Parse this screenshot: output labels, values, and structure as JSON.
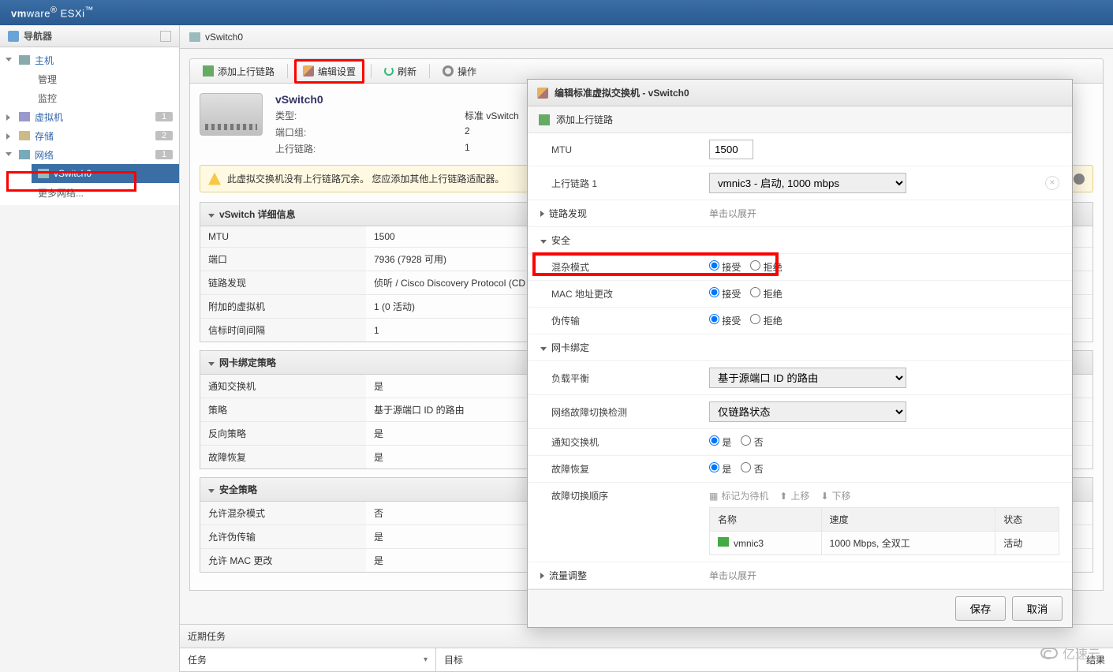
{
  "brand": {
    "a": "vm",
    "b": "ware",
    "c": " ESXi"
  },
  "nav": {
    "title": "导航器",
    "host": "主机",
    "manage": "管理",
    "monitor": "监控",
    "vm": "虚拟机",
    "vm_badge": "1",
    "ds": "存储",
    "ds_badge": "2",
    "net": "网络",
    "net_badge": "1",
    "vswitch": "vSwitch0",
    "more": "更多网络..."
  },
  "crumb": "vSwitch0",
  "toolbar": {
    "add": "添加上行链路",
    "edit": "编辑设置",
    "refresh": "刷新",
    "actions": "操作"
  },
  "card": {
    "name": "vSwitch0",
    "type_k": "类型:",
    "type_v": "标准 vSwitch",
    "pg_k": "端口组:",
    "pg_v": "2",
    "ul_k": "上行链路:",
    "ul_v": "1"
  },
  "notice": "此虚拟交换机没有上行链路冗余。 您应添加其他上行链路适配器。",
  "panel_detail": {
    "title": "vSwitch 详细信息",
    "mtu_k": "MTU",
    "mtu_v": "1500",
    "port_k": "端口",
    "port_v": "7936 (7928 可用)",
    "disc_k": "链路发现",
    "disc_v": "侦听 / Cisco Discovery Protocol (CD",
    "att_k": "附加的虚拟机",
    "att_v": "1 (0 活动)",
    "beacon_k": "信标时间间隔",
    "beacon_v": "1"
  },
  "panel_team": {
    "title": "网卡绑定策略",
    "notify_k": "通知交换机",
    "notify_v": "是",
    "policy_k": "策略",
    "policy_v": "基于源端口 ID 的路由",
    "rev_k": "反向策略",
    "rev_v": "是",
    "fb_k": "故障恢复",
    "fb_v": "是"
  },
  "panel_sec": {
    "title": "安全策略",
    "promisc_k": "允许混杂模式",
    "promisc_v": "否",
    "forged_k": "允许伪传输",
    "forged_v": "是",
    "mac_k": "允许 MAC 更改",
    "mac_v": "是"
  },
  "tasks": {
    "title": "近期任务",
    "col1": "任务",
    "col2": "目标",
    "result": "结果"
  },
  "modal": {
    "title": "编辑标准虚拟交换机 - vSwitch0",
    "addup": "添加上行链路",
    "mtu_l": "MTU",
    "mtu_v": "1500",
    "up1_l": "上行链路 1",
    "up1_v": "vmnic3 - 启动, 1000 mbps",
    "ld_l": "链路发现",
    "ld_v": "单击以展开",
    "sec_l": "安全",
    "promisc_l": "混杂模式",
    "accept": "接受",
    "reject": "拒绝",
    "macch_l": "MAC 地址更改",
    "forged_l": "伪传输",
    "team_l": "网卡绑定",
    "lb_l": "负载平衡",
    "lb_v": "基于源端口 ID 的路由",
    "fail_l": "网络故障切换检测",
    "fail_v": "仅链路状态",
    "notify_l": "通知交换机",
    "yes": "是",
    "no": "否",
    "fb_l": "故障恢复",
    "failorder_l": "故障切换顺序",
    "act_standby": "标记为待机",
    "act_up": "上移",
    "act_down": "下移",
    "col_name": "名称",
    "col_speed": "速度",
    "col_state": "状态",
    "nic": "vmnic3",
    "nic_speed": "1000 Mbps, 全双工",
    "nic_state": "活动",
    "traffic_l": "流量调整",
    "traffic_v": "单击以展开",
    "save": "保存",
    "cancel": "取消"
  },
  "watermark": "亿速云"
}
